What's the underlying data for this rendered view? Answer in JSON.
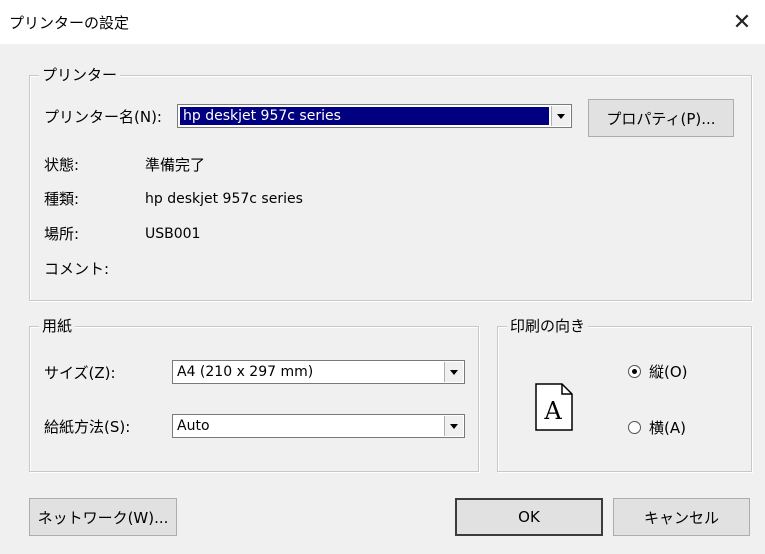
{
  "window": {
    "title": "プリンターの設定",
    "close_glyph": "✕"
  },
  "printer": {
    "group_label": "プリンター",
    "name_label": "プリンター名(N):",
    "name_value": "hp deskjet 957c series",
    "properties_button": "プロパティ(P)...",
    "status_label": "状態:",
    "status_value": "準備完了",
    "type_label": "種類:",
    "type_value": "hp deskjet 957c series",
    "location_label": "場所:",
    "location_value": "USB001",
    "comment_label": "コメント:",
    "comment_value": ""
  },
  "paper": {
    "group_label": "用紙",
    "size_label": "サイズ(Z):",
    "size_value": "A4 (210 x 297 mm)",
    "source_label": "給紙方法(S):",
    "source_value": "Auto"
  },
  "orientation": {
    "group_label": "印刷の向き",
    "icon_letter": "A",
    "portrait_label": "縦(O)",
    "portrait_selected": true,
    "landscape_label": "横(A)",
    "landscape_selected": false
  },
  "buttons": {
    "network": "ネットワーク(W)...",
    "ok": "OK",
    "cancel": "キャンセル"
  }
}
